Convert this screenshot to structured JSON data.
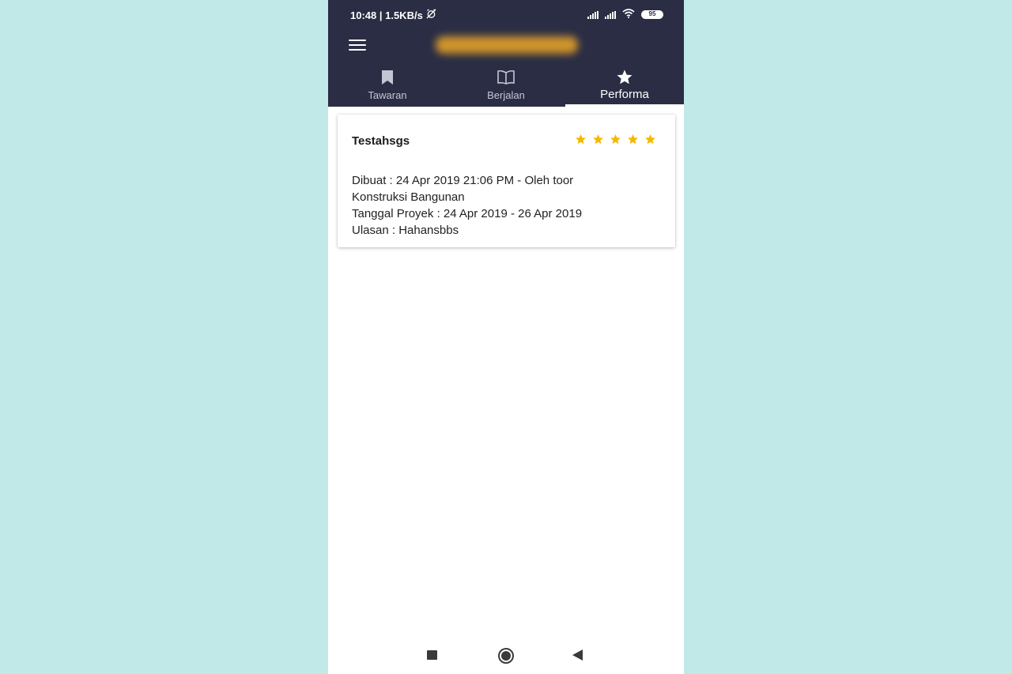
{
  "status_bar": {
    "time_speed": "10:48 | 1.5KB/s",
    "battery": "95"
  },
  "tabs": [
    {
      "label": "Tawaran",
      "icon": "bookmark-icon",
      "active": false
    },
    {
      "label": "Berjalan",
      "icon": "open-book-icon",
      "active": false
    },
    {
      "label": "Performa",
      "icon": "star-icon",
      "active": true
    }
  ],
  "review": {
    "title": "Testahsgs",
    "rating": 5,
    "rating_max": 5,
    "created": "Dibuat : 24 Apr 2019 21:06 PM - Oleh toor",
    "category": "Konstruksi Bangunan",
    "project_date": "Tanggal Proyek : 24 Apr 2019 - 26 Apr 2019",
    "review_text": "Ulasan : Hahansbbs"
  },
  "colors": {
    "header": "#2b2d44",
    "star": "#f5b800",
    "backdrop": "#c0e9e8"
  }
}
